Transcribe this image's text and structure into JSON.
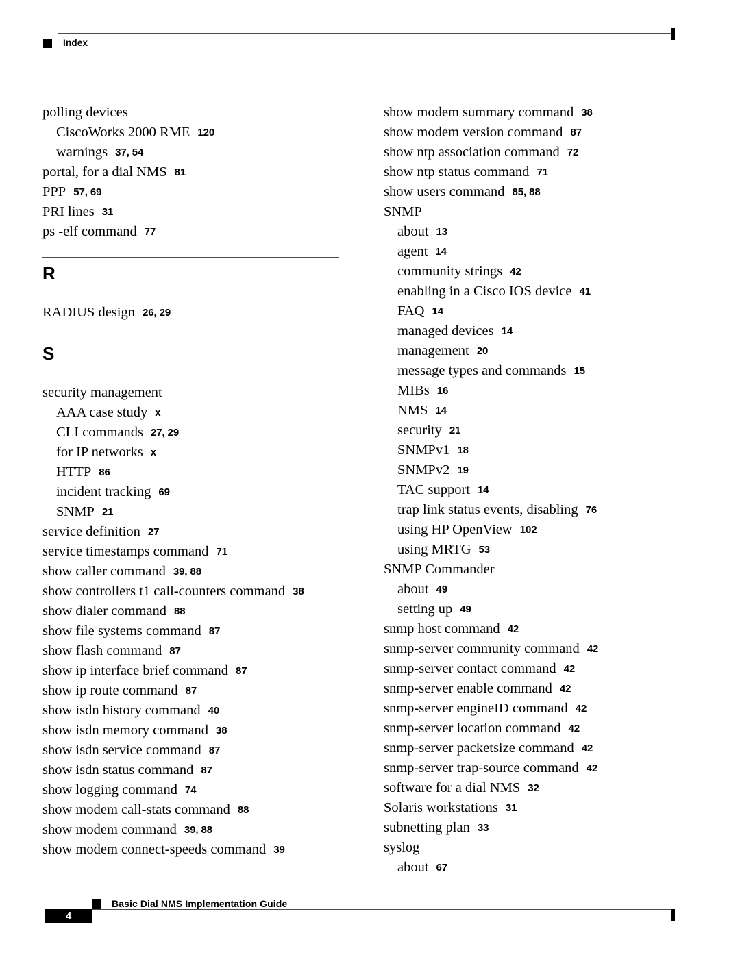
{
  "header": {
    "label": "Index",
    "marker_icon": "black-square-icon"
  },
  "footer": {
    "page_number": "4",
    "document_title": "Basic Dial NMS Implementation Guide",
    "marker_icon": "black-square-icon"
  },
  "colors": {
    "text": "#000000",
    "rule": "#4d4d4d",
    "marker": "#000000",
    "page_box_bg": "#000000",
    "page_box_text": "#ffffff"
  },
  "columns": [
    {
      "name": "left-column",
      "blocks": [
        {
          "type": "entries",
          "entries": [
            {
              "term": "polling devices",
              "pages": "",
              "level": 1
            },
            {
              "term": "CiscoWorks 2000 RME",
              "pages": "120",
              "level": 2
            },
            {
              "term": "warnings",
              "pages": "37, 54",
              "level": 2
            },
            {
              "term": "portal, for a dial NMS",
              "pages": "81",
              "level": 1
            },
            {
              "term": "PPP",
              "pages": "57, 69",
              "level": 1
            },
            {
              "term": "PRI lines",
              "pages": "31",
              "level": 1
            },
            {
              "term": "ps -elf command",
              "pages": "77",
              "level": 1
            }
          ]
        },
        {
          "type": "section",
          "letter": "R"
        },
        {
          "type": "entries",
          "entries": [
            {
              "term": "RADIUS design",
              "pages": "26, 29",
              "level": 1
            }
          ]
        },
        {
          "type": "section",
          "letter": "S"
        },
        {
          "type": "entries",
          "entries": [
            {
              "term": "security management",
              "pages": "",
              "level": 1
            },
            {
              "term": "AAA case study",
              "pages": "x",
              "level": 2
            },
            {
              "term": "CLI commands",
              "pages": "27, 29",
              "level": 2
            },
            {
              "term": "for IP networks",
              "pages": "x",
              "level": 2
            },
            {
              "term": "HTTP",
              "pages": "86",
              "level": 2
            },
            {
              "term": "incident tracking",
              "pages": "69",
              "level": 2
            },
            {
              "term": "SNMP",
              "pages": "21",
              "level": 2
            },
            {
              "term": "service definition",
              "pages": "27",
              "level": 1
            },
            {
              "term": "service timestamps command",
              "pages": "71",
              "level": 1
            },
            {
              "term": "show caller command",
              "pages": "39, 88",
              "level": 1
            },
            {
              "term": "show controllers t1 call-counters command",
              "pages": "38",
              "level": 1
            },
            {
              "term": "show dialer command",
              "pages": "88",
              "level": 1
            },
            {
              "term": "show file systems command",
              "pages": "87",
              "level": 1
            },
            {
              "term": "show flash command",
              "pages": "87",
              "level": 1
            },
            {
              "term": "show ip interface brief command",
              "pages": "87",
              "level": 1
            },
            {
              "term": "show ip route command",
              "pages": "87",
              "level": 1
            },
            {
              "term": "show isdn history command",
              "pages": "40",
              "level": 1
            },
            {
              "term": "show isdn memory command",
              "pages": "38",
              "level": 1
            },
            {
              "term": "show isdn service command",
              "pages": "87",
              "level": 1
            },
            {
              "term": "show isdn status command",
              "pages": "87",
              "level": 1
            },
            {
              "term": "show logging command",
              "pages": "74",
              "level": 1
            },
            {
              "term": "show modem call-stats command",
              "pages": "88",
              "level": 1
            },
            {
              "term": "show modem command",
              "pages": "39, 88",
              "level": 1
            },
            {
              "term": "show modem connect-speeds command",
              "pages": "39",
              "level": 1
            }
          ]
        }
      ]
    },
    {
      "name": "right-column",
      "blocks": [
        {
          "type": "entries",
          "entries": [
            {
              "term": "show modem summary command",
              "pages": "38",
              "level": 1
            },
            {
              "term": "show modem version command",
              "pages": "87",
              "level": 1
            },
            {
              "term": "show ntp association command",
              "pages": "72",
              "level": 1
            },
            {
              "term": "show ntp status command",
              "pages": "71",
              "level": 1
            },
            {
              "term": "show users command",
              "pages": "85, 88",
              "level": 1
            },
            {
              "term": "SNMP",
              "pages": "",
              "level": 1
            },
            {
              "term": "about",
              "pages": "13",
              "level": 2
            },
            {
              "term": "agent",
              "pages": "14",
              "level": 2
            },
            {
              "term": "community strings",
              "pages": "42",
              "level": 2
            },
            {
              "term": "enabling in a Cisco IOS device",
              "pages": "41",
              "level": 2
            },
            {
              "term": "FAQ",
              "pages": "14",
              "level": 2
            },
            {
              "term": "managed devices",
              "pages": "14",
              "level": 2
            },
            {
              "term": "management",
              "pages": "20",
              "level": 2
            },
            {
              "term": "message types and commands",
              "pages": "15",
              "level": 2
            },
            {
              "term": "MIBs",
              "pages": "16",
              "level": 2
            },
            {
              "term": "NMS",
              "pages": "14",
              "level": 2
            },
            {
              "term": "security",
              "pages": "21",
              "level": 2
            },
            {
              "term": "SNMPv1",
              "pages": "18",
              "level": 2
            },
            {
              "term": "SNMPv2",
              "pages": "19",
              "level": 2
            },
            {
              "term": "TAC support",
              "pages": "14",
              "level": 2
            },
            {
              "term": "trap link status events, disabling",
              "pages": "76",
              "level": 2
            },
            {
              "term": "using HP OpenView",
              "pages": "102",
              "level": 2
            },
            {
              "term": "using MRTG",
              "pages": "53",
              "level": 2
            },
            {
              "term": "SNMP Commander",
              "pages": "",
              "level": 1
            },
            {
              "term": "about",
              "pages": "49",
              "level": 2
            },
            {
              "term": "setting up",
              "pages": "49",
              "level": 2
            },
            {
              "term": "snmp host command",
              "pages": "42",
              "level": 1
            },
            {
              "term": "snmp-server community command",
              "pages": "42",
              "level": 1
            },
            {
              "term": "snmp-server contact command",
              "pages": "42",
              "level": 1
            },
            {
              "term": "snmp-server enable command",
              "pages": "42",
              "level": 1
            },
            {
              "term": "snmp-server engineID command",
              "pages": "42",
              "level": 1
            },
            {
              "term": "snmp-server location command",
              "pages": "42",
              "level": 1
            },
            {
              "term": "snmp-server packetsize command",
              "pages": "42",
              "level": 1
            },
            {
              "term": "snmp-server trap-source command",
              "pages": "42",
              "level": 1
            },
            {
              "term": "software for a dial NMS",
              "pages": "32",
              "level": 1
            },
            {
              "term": "Solaris workstations",
              "pages": "31",
              "level": 1
            },
            {
              "term": "subnetting plan",
              "pages": "33",
              "level": 1
            },
            {
              "term": "syslog",
              "pages": "",
              "level": 1
            },
            {
              "term": "about",
              "pages": "67",
              "level": 2
            }
          ]
        }
      ]
    }
  ]
}
